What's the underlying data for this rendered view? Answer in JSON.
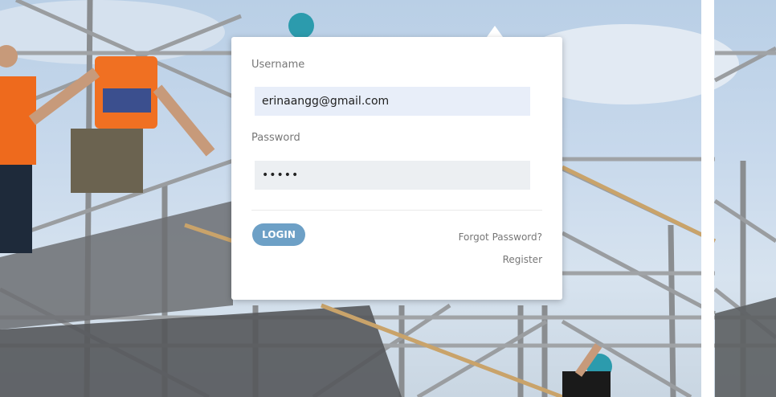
{
  "form": {
    "username_label": "Username",
    "username_value": "erinaangg@gmail.com",
    "password_label": "Password",
    "password_value": "•••••",
    "login_label": "LOGIN",
    "forgot_label": "Forgot Password?",
    "register_label": "Register"
  },
  "colors": {
    "login_button": "#6da0c6",
    "username_field_bg": "#e8eef9",
    "password_field_bg": "#eceff2"
  }
}
